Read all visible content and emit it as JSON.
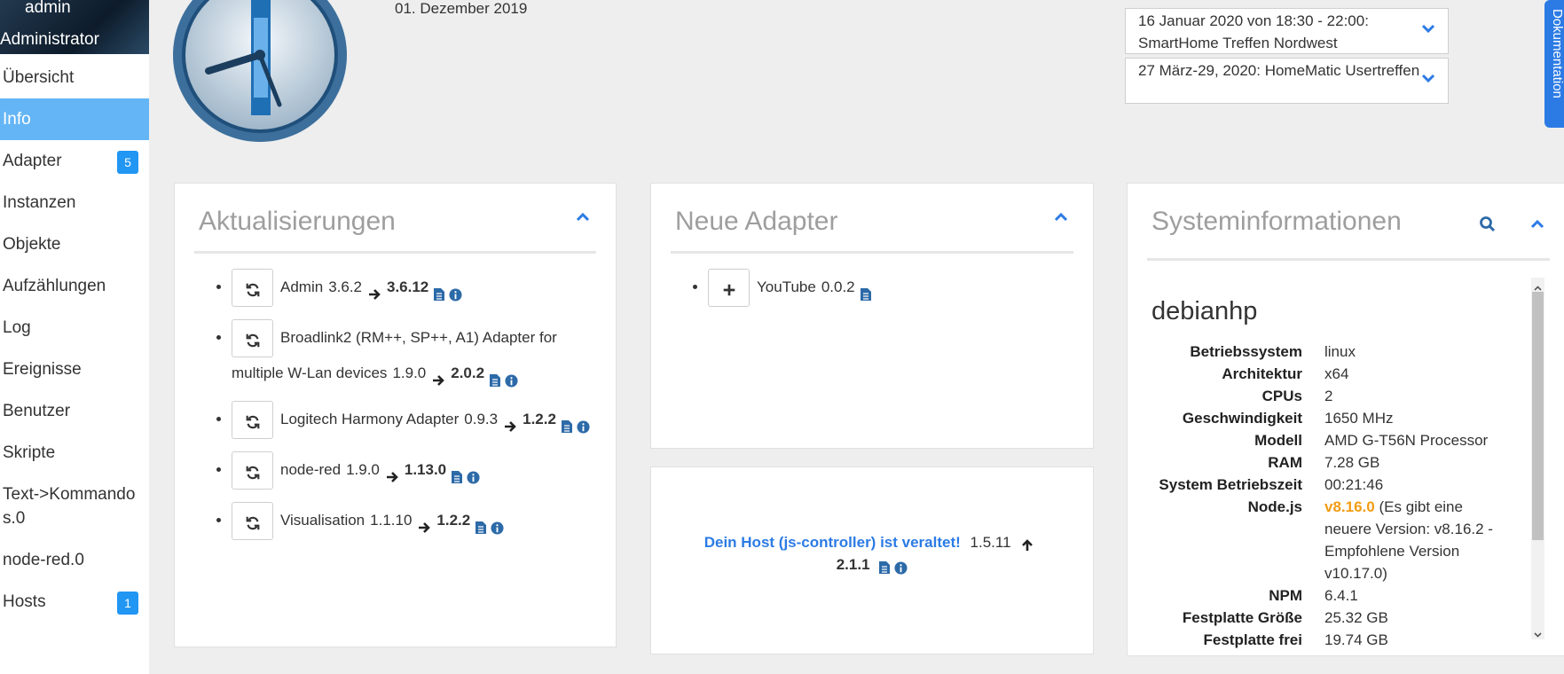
{
  "user": {
    "name": "admin",
    "role": "Administrator"
  },
  "nav": [
    {
      "label": "Übersicht"
    },
    {
      "label": "Info",
      "active": true
    },
    {
      "label": "Adapter",
      "badge": "5"
    },
    {
      "label": "Instanzen"
    },
    {
      "label": "Objekte"
    },
    {
      "label": "Aufzählungen"
    },
    {
      "label": "Log"
    },
    {
      "label": "Ereignisse"
    },
    {
      "label": "Benutzer"
    },
    {
      "label": "Skripte"
    },
    {
      "label": "Text->Kommandos.0"
    },
    {
      "label": "node-red.0"
    },
    {
      "label": "Hosts",
      "badge": "1"
    }
  ],
  "header": {
    "date": "01. Dezember 2019",
    "events": [
      "16 Januar 2020 von 18:30 - 22:00: SmartHome Treffen Nordwest",
      "27 März-29, 2020: HomeMatic Usertreffen"
    ],
    "doc_tab": "Dokumentation"
  },
  "updates": {
    "title": "Aktualisierungen",
    "items": [
      {
        "name": "Admin",
        "from": "3.6.2",
        "to": "3.6.12"
      },
      {
        "name": "Broadlink2 (RM++, SP++, A1) Adapter for multiple W-Lan devices",
        "from": "1.9.0",
        "to": "2.0.2"
      },
      {
        "name": "Logitech Harmony Adapter",
        "from": "0.9.3",
        "to": "1.2.2"
      },
      {
        "name": "node-red",
        "from": "1.9.0",
        "to": "1.13.0"
      },
      {
        "name": "Visualisation",
        "from": "1.1.10",
        "to": "1.2.2"
      }
    ]
  },
  "new_adapters": {
    "title": "Neue Adapter",
    "items": [
      {
        "name": "YouTube",
        "version": "0.0.2"
      }
    ]
  },
  "host_warning": {
    "label": "Dein Host (js-controller) ist veraltet!",
    "from": "1.5.11",
    "to": "2.1.1"
  },
  "sysinfo": {
    "title": "Systeminformationen",
    "host": "debianhp",
    "rows": [
      {
        "k": "Betriebssystem",
        "v": "linux"
      },
      {
        "k": "Architektur",
        "v": "x64"
      },
      {
        "k": "CPUs",
        "v": "2"
      },
      {
        "k": "Geschwindigkeit",
        "v": "1650 MHz"
      },
      {
        "k": "Modell",
        "v": "AMD G-T56N Processor"
      },
      {
        "k": "RAM",
        "v": "7.28 GB"
      },
      {
        "k": "System Betriebszeit",
        "v": "00:21:46"
      },
      {
        "k": "Node.js",
        "v": "v8.16.0",
        "note": "(Es gibt eine neuere Version: v8.16.2 - Empfohlene Version v10.17.0)"
      },
      {
        "k": "NPM",
        "v": "6.4.1"
      },
      {
        "k": "Festplatte Größe",
        "v": "25.32 GB"
      },
      {
        "k": "Festplatte frei",
        "v": "19.74 GB"
      }
    ]
  },
  "colors": {
    "accent": "#2c7be5",
    "active_nav": "#64b5f6",
    "badge": "#2196f3",
    "node_warn": "#f39c12"
  }
}
